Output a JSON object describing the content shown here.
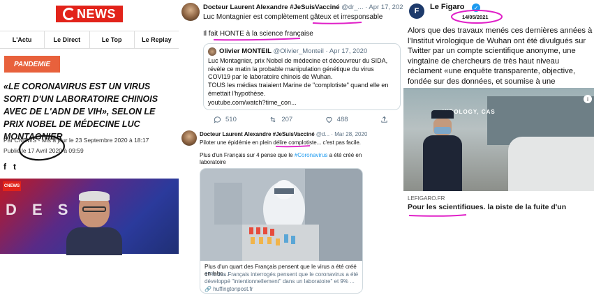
{
  "cnews": {
    "logo": "NEWS",
    "nav": [
      "L'Actu",
      "Le Direct",
      "Le Top",
      "Le Replay"
    ],
    "badge": "PANDEMIE",
    "headline": "«LE CORONAVIRUS EST UN VIRUS SORTI D'UN LABORATOIRE CHINOIS AVEC DE L'ADN DE VIH», SELON LE PRIX NOBEL DE MÉDECINE LUC MONTAGNIER",
    "meta_line1": "Par CNEWS - Mis à jour le 23 Septembre 2020 à 18:17",
    "meta_line2": "Publié le 17 Avril 2020 à 09:59",
    "social": [
      "f",
      "t"
    ],
    "video_logo": "CNEWS",
    "video_letters": "D E S P"
  },
  "tweet1": {
    "author": "Docteur Laurent Alexandre #JeSuisVacciné",
    "handle_date": "@dr_... · Apr 17, 2020",
    "line1": "Luc Montagnier est complètement gâteux et irresponsable",
    "line2": "Il fait HONTE à la science française",
    "quote": {
      "author": "Olivier MONTEIL",
      "handle_date": "@Olivier_Monteil · Apr 17, 2020",
      "text": "Luc Montagnier, prix Nobel de médecine et découvreur du SIDA, révèle ce matin la probable manipulation génétique du virus COVI19 par le laboratoire chinois de Wuhan.",
      "text2": "TOUS les médias traiaient Marine de \"complotiste\" quand elle en émettait l'hypothèse.",
      "link": "youtube.com/watch?time_con..."
    },
    "replies": "510",
    "retweets": "207",
    "likes": "488"
  },
  "tweet2": {
    "author": "Docteur Laurent Alexandre #JeSuisVacciné",
    "handle_date": "@d... · Mar 28, 2020",
    "line1": "Piloter une épidémie en plein délire complotiste... c'est pas facile.",
    "line2_pre": "Plus d'un Français sur 4 pense que le ",
    "line2_hashtag": "#Coronavirus",
    "line2_post": " a été créé en laboratoire",
    "card_title": "Plus d'un quart des Français pensent que le virus a été créé en labo...",
    "card_desc": "17% des Français interrogés pensent que le coronavirus a été développé \"intentionnellement\" dans un laboratoire\" et 9% ...",
    "card_link": "huffingtonpost.fr"
  },
  "figaro": {
    "logo": "F",
    "name": "Le Figaro",
    "date": "14/05/2021",
    "text": "Alors que des travaux menés ces dernières années à l'Institut virologique de Wuhan ont été divulgués sur Twitter par un compte scientifique anonyme, une vingtaine de chercheurs de très haut niveau réclament «une enquête transparente, objective, fondée sur des données, et soumise à une surveillance indépendante»",
    "image_sign": "VIROLOGY, CAS",
    "source": "LEFIGARO.FR",
    "headline": "Pour les scientifiques, la piste de la fuite d'un laboratoire n'est plus taboue"
  },
  "colors": {
    "cnews_red": "#e2231a",
    "badge_orange": "#e8613c",
    "annotation_pink": "#e020c8",
    "twitter_blue": "#1d9bf0"
  }
}
